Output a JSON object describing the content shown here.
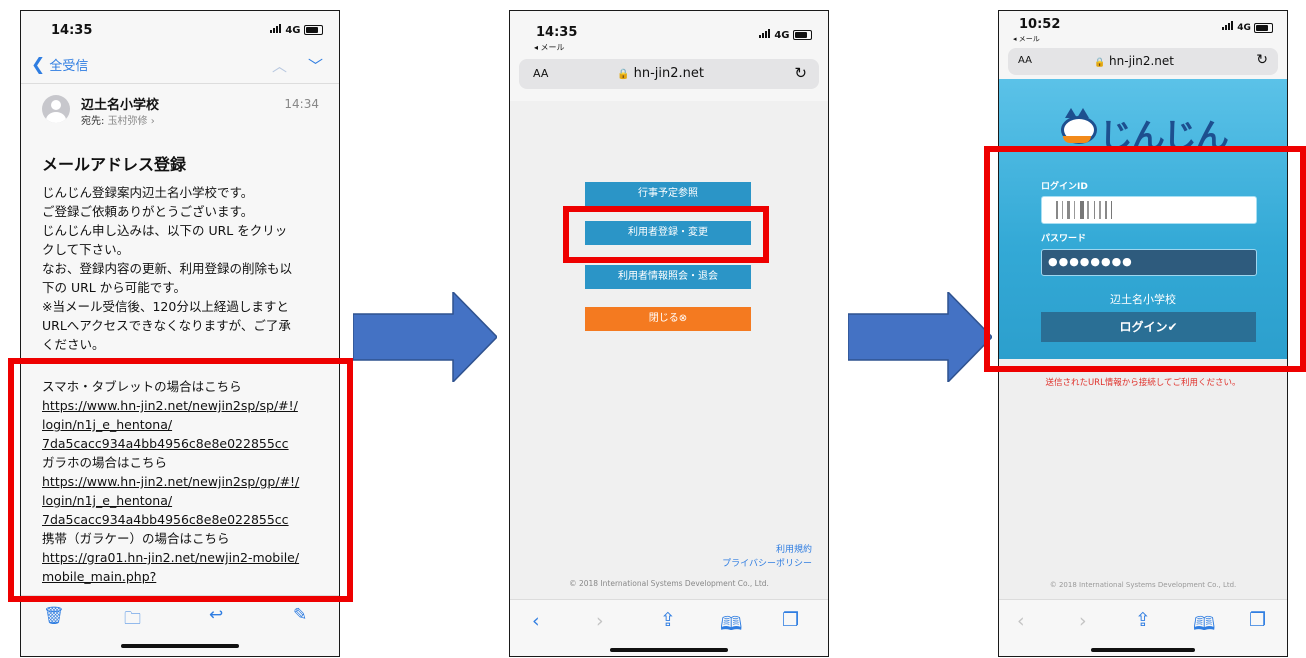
{
  "mail": {
    "status_time": "14:35",
    "network": "4G",
    "back_label": "全受信",
    "sender": "辺土名小学校",
    "recipient_prefix": "宛先:",
    "recipient_name": "玉村弥修",
    "received_time": "14:34",
    "subject": "メールアドレス登録",
    "body_lines": [
      "じんじん登録案内辺土名小学校です。",
      "ご登録ご依頼ありがとうございます。",
      "じんじん申し込みは、以下の URL をクリッ",
      "クして下さい。",
      "なお、登録内容の更新、利用登録の削除も以",
      "下の URL から可能です。",
      "※当メール受信後、120分以上経過しますと",
      "URLへアクセスできなくなりますが、ご了承",
      "ください。"
    ],
    "smartphone_label": "スマホ・タブレットの場合はこちら",
    "smartphone_link_lines": [
      "https://www.hn-jin2.net/newjin2sp/sp/#!/",
      "login/n1j_e_hentona/",
      "7da5cacc934a4bb4956c8e8e022855cc"
    ],
    "garaho_label": "ガラホの場合はこちら",
    "garaho_link_lines": [
      "https://www.hn-jin2.net/newjin2sp/gp/#!/",
      "login/n1j_e_hentona/",
      "7da5cacc934a4bb4956c8e8e022855cc"
    ],
    "keitai_label": "携帯（ガラケー）の場合はこちら",
    "keitai_link_lines": [
      "https://gra01.hn-jin2.net/newjin2-mobile/",
      "mobile_main.php?"
    ]
  },
  "menu_page": {
    "status_time": "14:35",
    "back_app": "◂ メール",
    "network": "4G",
    "text_size": "AA",
    "domain": "hn-jin2.net",
    "buttons": [
      "行事予定参照",
      "利用者登録・変更",
      "利用者情報照会・退会"
    ],
    "close_label": "閉じる⊗",
    "terms_link": "利用規約",
    "privacy_link": "プライバシーポリシー",
    "copyright": "© 2018 International Systems Development Co., Ltd."
  },
  "login_page": {
    "status_time": "10:52",
    "back_app": "◂ メール",
    "network": "4G",
    "text_size": "AA",
    "domain": "hn-jin2.net",
    "logo_text": "じんじん",
    "login_id_label": "ログインID",
    "password_label": "パスワード",
    "password_mask": "●●●●●●●●",
    "school_name": "辺土名小学校",
    "login_button": "ログイン✔",
    "notice": "送信されたURL情報から接続してご利用ください。",
    "copyright": "© 2018 International Systems Development Co., Ltd."
  },
  "colors": {
    "annotation_red": "#ee0000",
    "arrow_blue": "#4472c4",
    "menu_button_blue": "#2b95c7",
    "close_orange": "#f47a20",
    "ios_blue": "#2f7de1"
  }
}
